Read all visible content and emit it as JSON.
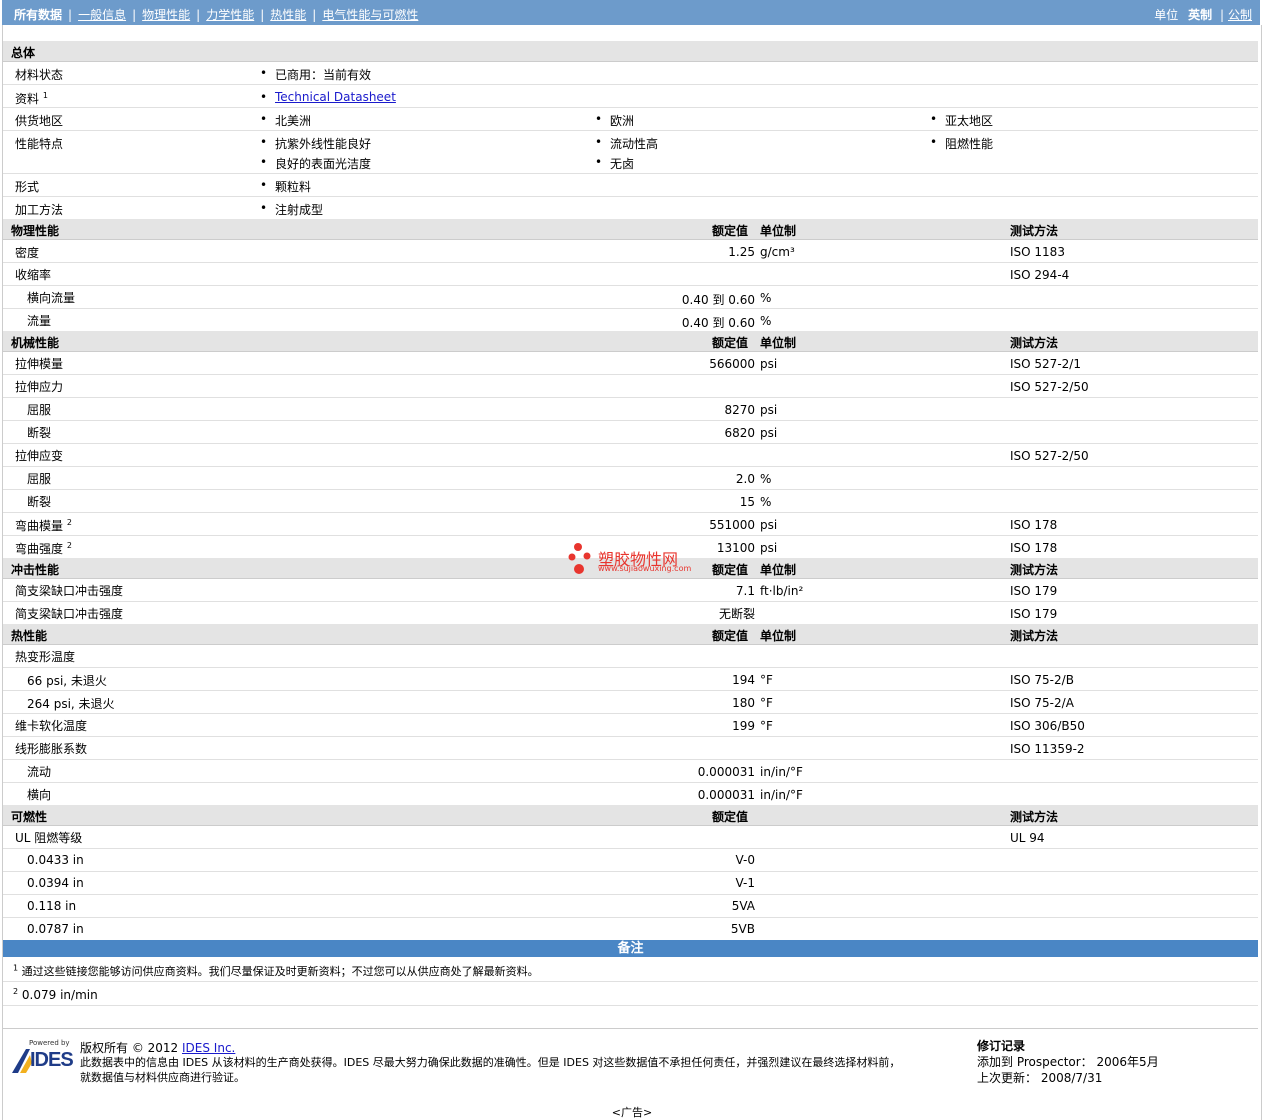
{
  "nav": {
    "tabs": [
      "所有数据",
      "一般信息",
      "物理性能",
      "力学性能",
      "热性能",
      "电气性能与可燃性"
    ],
    "units_label": "单位",
    "unit_selected": "英制",
    "unit_other": "公制"
  },
  "general": {
    "title": "总体",
    "status_label": "材料状态",
    "status_value": "已商用：当前有效",
    "info_label": "资料",
    "info_sup": "1",
    "info_link": "Technical Datasheet",
    "supply_label": "供货地区",
    "supply": [
      "北美洲",
      "欧洲",
      "亚太地区"
    ],
    "features_label": "性能特点",
    "features": [
      "抗紫外线性能良好",
      "流动性高",
      "阻燃性能",
      "良好的表面光洁度",
      "无卤"
    ],
    "form_label": "形式",
    "form_value": "颗粒料",
    "process_label": "加工方法",
    "process_value": "注射成型"
  },
  "cols": {
    "nominal": "额定值",
    "unit": "单位制",
    "test": "测试方法"
  },
  "physical": {
    "title": "物理性能",
    "density_label": "密度",
    "density_value": "1.25",
    "density_unit": "g/cm³",
    "density_test": "ISO 1183",
    "shrink_label": "收缩率",
    "shrink_test": "ISO 294-4",
    "shrink_cross_label": "横向流量",
    "shrink_cross_value": "0.40 到  0.60",
    "shrink_cross_unit": "%",
    "shrink_flow_label": "流量",
    "shrink_flow_value": "0.40 到  0.60",
    "shrink_flow_unit": "%"
  },
  "mechanical": {
    "title": "机械性能",
    "tmod_label": "拉伸模量",
    "tmod_value": "566000",
    "tmod_unit": "psi",
    "tmod_test": "ISO 527-2/1",
    "tstress_label": "拉伸应力",
    "tstress_test": "ISO 527-2/50",
    "yield_label": "屈服",
    "yield_value": "8270",
    "yield_unit": "psi",
    "break_label": "断裂",
    "break_value": "6820",
    "break_unit": "psi",
    "tstrain_label": "拉伸应变",
    "tstrain_test": "ISO 527-2/50",
    "syield_label": "屈服",
    "syield_value": "2.0",
    "syield_unit": "%",
    "sbreak_label": "断裂",
    "sbreak_value": "15",
    "sbreak_unit": "%",
    "fmod_label": "弯曲模量",
    "fmod_sup": "2",
    "fmod_value": "551000",
    "fmod_unit": "psi",
    "fmod_test": "ISO 178",
    "fstr_label": "弯曲强度",
    "fstr_sup": "2",
    "fstr_value": "13100",
    "fstr_unit": "psi",
    "fstr_test": "ISO 178"
  },
  "impact": {
    "title": "冲击性能",
    "r1_label": "简支梁缺口冲击强度",
    "r1_value": "7.1",
    "r1_unit": "ft·lb/in²",
    "r1_test": "ISO 179",
    "r2_label": "简支梁缺口冲击强度",
    "r2_value": "无断裂",
    "r2_test": "ISO 179"
  },
  "thermal": {
    "title": "热性能",
    "hdt_label": "热变形温度",
    "hdt1_label": "66 psi, 未退火",
    "hdt1_value": "194",
    "hdt1_unit": "°F",
    "hdt1_test": "ISO 75-2/B",
    "hdt2_label": "264 psi, 未退火",
    "hdt2_value": "180",
    "hdt2_unit": "°F",
    "hdt2_test": "ISO 75-2/A",
    "vicat_label": "维卡软化温度",
    "vicat_value": "199",
    "vicat_unit": "°F",
    "vicat_test": "ISO 306/B50",
    "clte_label": "线形膨胀系数",
    "clte_test": "ISO 11359-2",
    "clte_flow_label": "流动",
    "clte_flow_value": "0.000031",
    "clte_flow_unit": "in/in/°F",
    "clte_cross_label": "横向",
    "clte_cross_value": "0.000031",
    "clte_cross_unit": "in/in/°F"
  },
  "flammability": {
    "title": "可燃性",
    "ul_label": "UL 阻燃等级",
    "ul_test": "UL 94",
    "rows": [
      {
        "label": "0.0433 in",
        "value": "V-0"
      },
      {
        "label": "0.0394 in",
        "value": "V-1"
      },
      {
        "label": "0.118 in",
        "value": "5VA"
      },
      {
        "label": "0.0787 in",
        "value": "5VB"
      }
    ]
  },
  "notes": {
    "title": "备注",
    "n1_sup": "1",
    "n1_text": "通过这些链接您能够访问供应商资料。我们尽量保证及时更新资料；不过您可以从供应商处了解最新资料。",
    "n2_sup": "2",
    "n2_text": "0.079 in/min"
  },
  "footer": {
    "powered": "Powered by",
    "logo_text": "IDES",
    "copyright": "版权所有  © 2012",
    "company_link": "IDES Inc.",
    "disclaimer1": "此数据表中的信息由  IDES 从该材料的生产商处获得。IDES 尽最大努力确保此数据的准确性。但是  IDES 对这些数据值不承担任何责任，并强烈建议在最终选择材料前，",
    "disclaimer2": "就数据值与材料供应商进行验证。",
    "rev_title": "修订记录",
    "added_label": "添加到  Prospector：",
    "added_date": "2006年5月",
    "updated_label": "上次更新：",
    "updated_date": "2008/7/31"
  },
  "watermark": {
    "text": "塑胶物性网",
    "url": "www.sujiaowuxing.com",
    "color": "#e8352e"
  },
  "ad": "<广告>"
}
